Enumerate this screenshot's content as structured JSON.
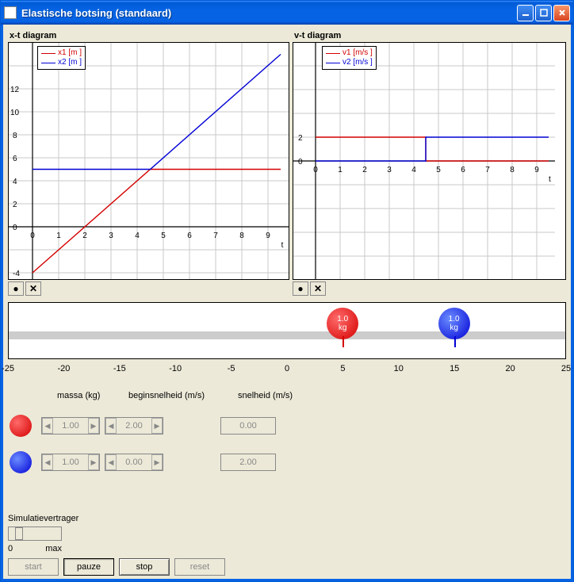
{
  "window": {
    "title": "Elastische botsing (standaard)"
  },
  "charts": {
    "xt": {
      "title": "x-t diagram",
      "legend": [
        "x1 [m ]",
        "x2 [m ]"
      ],
      "xlabel": "t"
    },
    "vt": {
      "title": "v-t diagram",
      "legend": [
        "v1 [m/s ]",
        "v2 [m/s ]"
      ],
      "xlabel": "t"
    }
  },
  "chart_data": [
    {
      "type": "line",
      "title": "x-t diagram",
      "xlabel": "t",
      "ylabel": "",
      "xlim": [
        0,
        9.5
      ],
      "ylim": [
        -4,
        16
      ],
      "x": [
        0,
        1,
        2,
        3,
        4,
        4.5,
        5,
        6,
        7,
        8,
        9,
        9.5
      ],
      "series": [
        {
          "name": "x1 [m]",
          "color": "#d40000",
          "values": [
            -4,
            -2,
            0,
            2,
            4,
            5,
            5,
            5,
            5,
            5,
            5,
            5
          ]
        },
        {
          "name": "x2 [m]",
          "color": "#0000d4",
          "values": [
            5,
            5,
            5,
            5,
            5,
            5,
            6,
            8,
            10,
            12,
            14,
            15
          ]
        }
      ]
    },
    {
      "type": "line",
      "title": "v-t diagram",
      "xlabel": "t",
      "ylabel": "",
      "xlim": [
        0,
        9.5
      ],
      "ylim": [
        -10,
        10
      ],
      "x": [
        0,
        1,
        2,
        3,
        4,
        4.49,
        4.5,
        5,
        6,
        7,
        8,
        9,
        9.5
      ],
      "series": [
        {
          "name": "v1 [m/s]",
          "color": "#d40000",
          "values": [
            2,
            2,
            2,
            2,
            2,
            2,
            0,
            0,
            0,
            0,
            0,
            0,
            0
          ]
        },
        {
          "name": "v2 [m/s]",
          "color": "#0000d4",
          "values": [
            0,
            0,
            0,
            0,
            0,
            0,
            2,
            2,
            2,
            2,
            2,
            2,
            2
          ]
        }
      ]
    }
  ],
  "track": {
    "ball1": {
      "label_top": "1.0",
      "label_bot": "kg",
      "x": 5
    },
    "ball2": {
      "label_top": "1.0",
      "label_bot": "kg",
      "x": 15
    },
    "ticks": [
      -25,
      -20,
      -15,
      -10,
      -5,
      0,
      5,
      10,
      15,
      20,
      25
    ],
    "marks": {
      "red": 5,
      "blue": 15
    }
  },
  "headers": {
    "massa": "massa (kg)",
    "begin": "beginsnelheid (m/s)",
    "snelheid": "snelheid (m/s)"
  },
  "objects": {
    "red": {
      "mass": "1.00",
      "v0": "2.00",
      "v": "0.00"
    },
    "blue": {
      "mass": "1.00",
      "v0": "0.00",
      "v": "2.00"
    }
  },
  "slider": {
    "label": "Simulatievertrager",
    "min": "0",
    "max": "max"
  },
  "buttons": {
    "start": "start",
    "pauze": "pauze",
    "stop": "stop",
    "reset": "reset"
  }
}
